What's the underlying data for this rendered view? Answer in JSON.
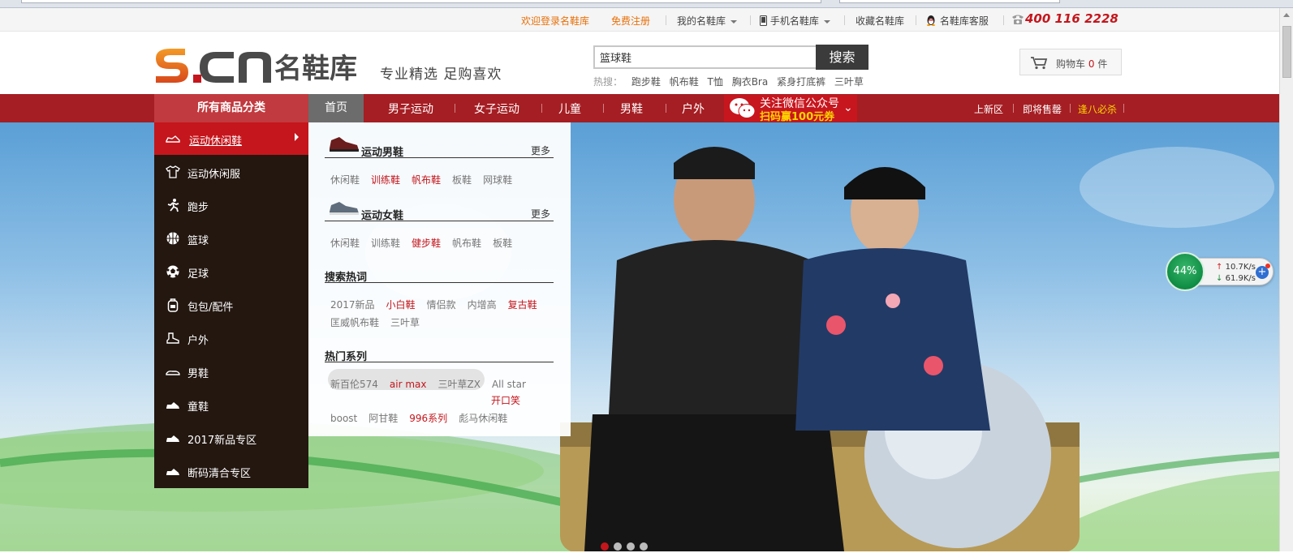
{
  "topbar": {
    "welcome_login": "欢迎登录名鞋库",
    "register": "免费注册",
    "my_account": "我的名鞋库",
    "mobile": "手机名鞋库",
    "favorite": "收藏名鞋库",
    "service": "名鞋库客服",
    "hotline": "400 116 2228"
  },
  "header": {
    "logo_text": "S.CN",
    "logo_cn": "名鞋库",
    "slogan": "专业精选 足购喜欢"
  },
  "search": {
    "value": "篮球鞋",
    "button": "搜索",
    "hot_label": "热搜：",
    "hot_terms": [
      "跑步鞋",
      "帆布鞋",
      "T恤",
      "胸衣Bra",
      "紧身打底裤",
      "三叶草"
    ]
  },
  "cart": {
    "label": "购物车",
    "count": "0",
    "unit": "件"
  },
  "nav": {
    "all_categories": "所有商品分类",
    "home": "首页",
    "items": [
      "男子运动",
      "女子运动",
      "儿童",
      "男鞋",
      "户外"
    ],
    "wechat_line1": "关注微信公众号",
    "wechat_line2": "扫码赢100元券",
    "right_links": [
      "上新区",
      "即将售罄",
      "逢八必杀"
    ]
  },
  "sidemenu": [
    "运动休闲鞋",
    "运动休闲服",
    "跑步",
    "篮球",
    "足球",
    "包包/配件",
    "户外",
    "男鞋",
    "童鞋",
    "2017新品专区",
    "断码清合专区"
  ],
  "panel": {
    "more": "更多",
    "men_title": "运动男鞋",
    "men_links": [
      "休闲鞋",
      "训练鞋",
      "帆布鞋",
      "板鞋",
      "网球鞋"
    ],
    "women_title": "运动女鞋",
    "women_links": [
      "休闲鞋",
      "训练鞋",
      "健步鞋",
      "帆布鞋",
      "板鞋"
    ],
    "hot_title": "搜索热词",
    "hot_row1": [
      "2017新品",
      "小白鞋",
      "情侣款",
      "内增高",
      "复古鞋"
    ],
    "hot_row2": [
      "匡威帆布鞋",
      "三叶草"
    ],
    "series_title": "热门系列",
    "series_row1": [
      "新百伦574",
      "air max",
      "三叶草ZX",
      "All star"
    ],
    "series_extra": "开口笑",
    "series_row3": [
      "boost",
      "阿甘鞋",
      "996系列",
      "彪马休闲鞋"
    ]
  },
  "speed": {
    "percent": "44%",
    "up": "10.7K/s",
    "down": "61.9K/s"
  }
}
